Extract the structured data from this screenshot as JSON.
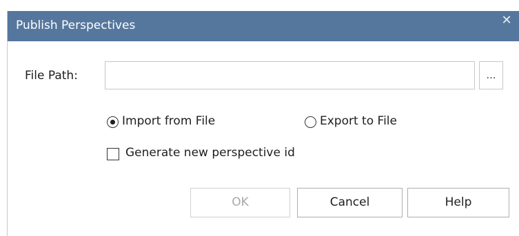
{
  "dialog": {
    "title": "Publish Perspectives",
    "close_glyph": "✕"
  },
  "file_path": {
    "label": "File Path:",
    "value": "",
    "browse_label": "..."
  },
  "options": {
    "import_label": "Import from File",
    "export_label": "Export to File",
    "selected": "import",
    "generate_id_label": "Generate new perspective id",
    "generate_id_checked": false
  },
  "buttons": {
    "ok": "OK",
    "ok_enabled": false,
    "cancel": "Cancel",
    "help": "Help"
  },
  "colors": {
    "titlebar": "#56779d",
    "disabled_text": "#a8a8a8"
  }
}
